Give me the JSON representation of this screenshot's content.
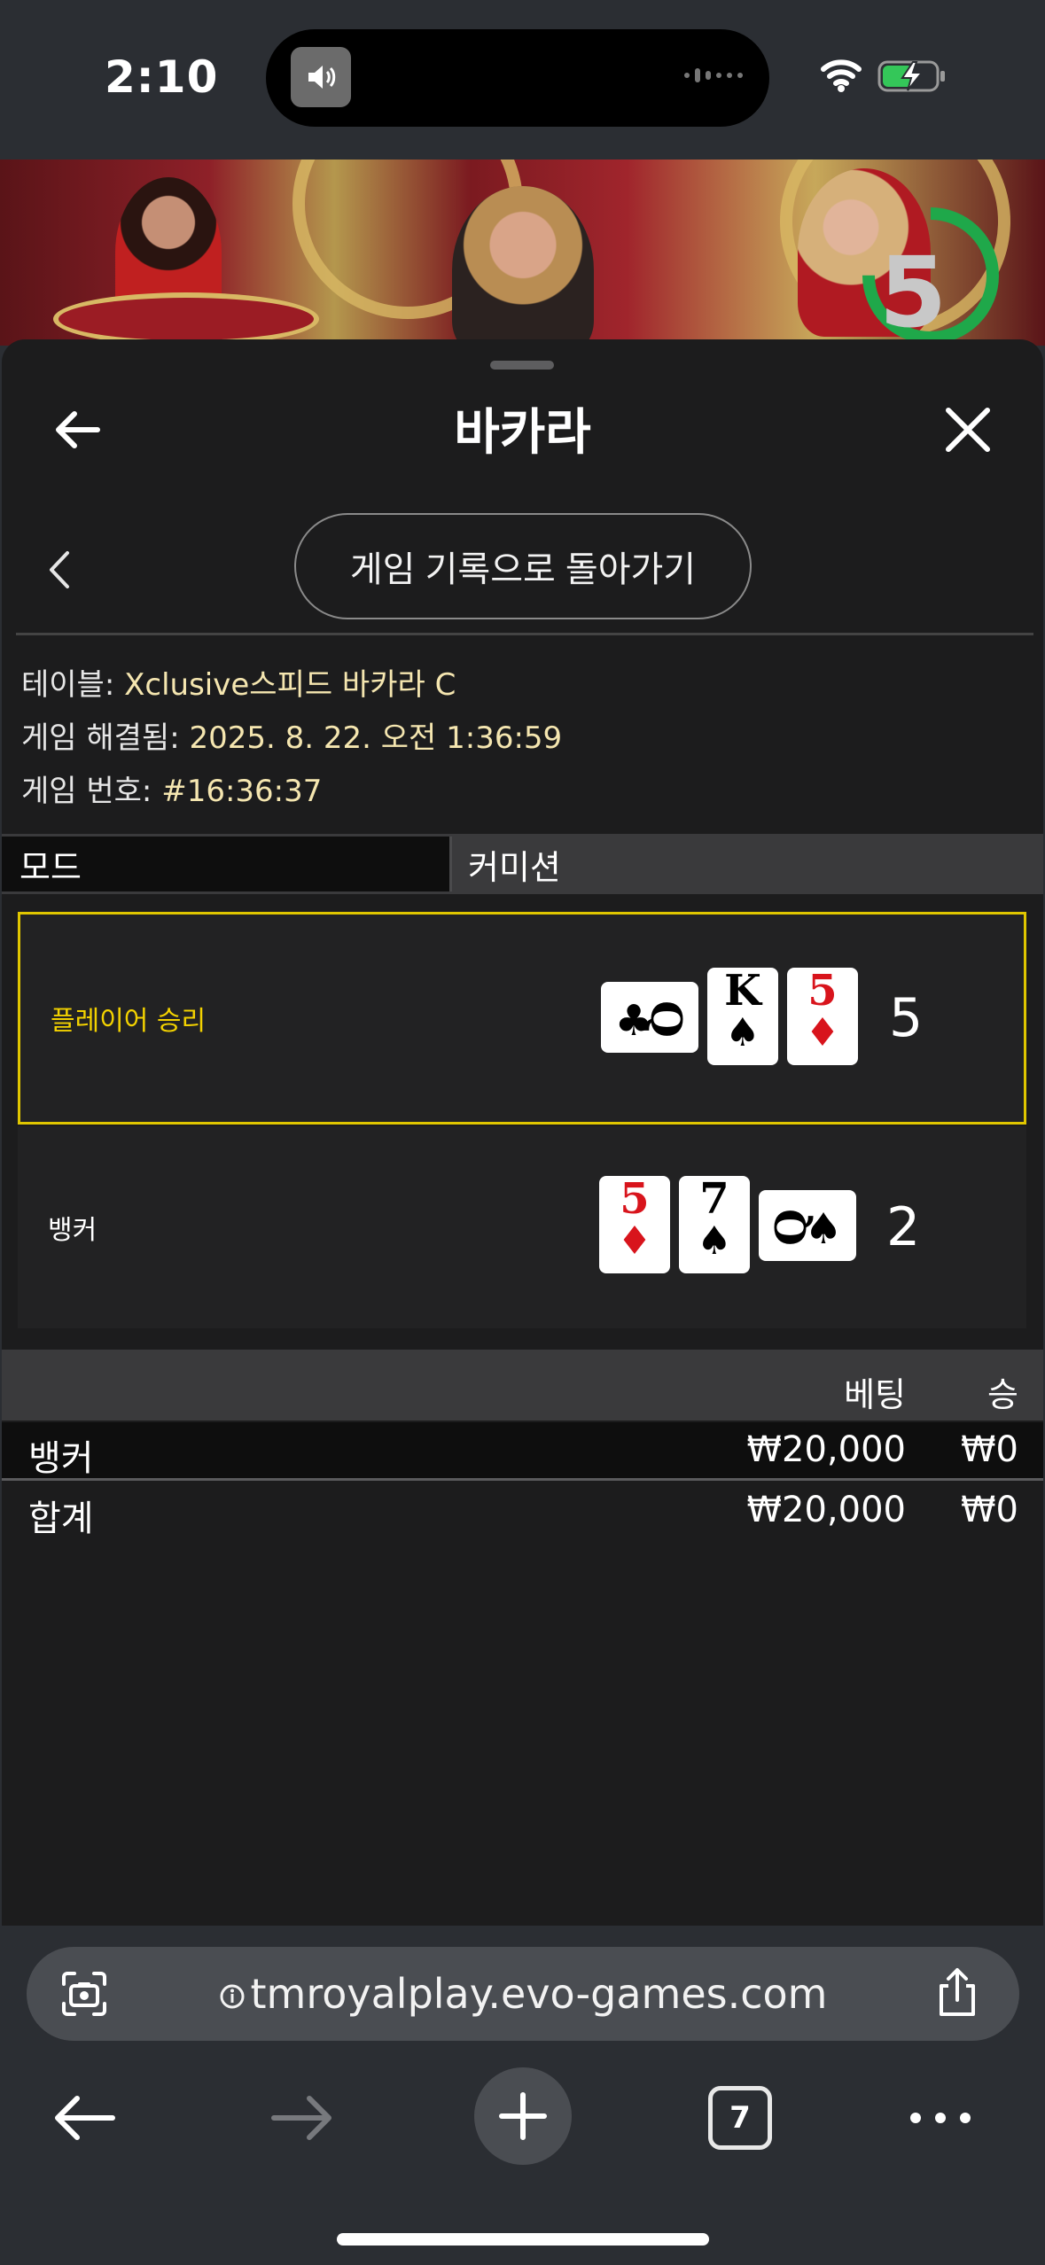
{
  "status_bar": {
    "time": "2:10"
  },
  "video": {
    "countdown": "5"
  },
  "header": {
    "title": "바카라"
  },
  "subheader": {
    "return_label": "게임 기록으로 돌아가기"
  },
  "info": {
    "table_label": "테이블: ",
    "table_value": "Xclusive스피드 바카라 C",
    "resolved_label": "게임 해결됨: ",
    "resolved_value": "2025. 8. 22. 오전 1:36:59",
    "number_label": "게임 번호: ",
    "number_value": "#16:36:37"
  },
  "tabs": {
    "mode": "모드",
    "commission": "커미션"
  },
  "results": {
    "player": {
      "label": "플레이어 승리",
      "score": "5",
      "cards": [
        {
          "rank": "Q",
          "suit": "♣",
          "color": "#000000",
          "orientation": "horizontal"
        },
        {
          "rank": "K",
          "suit": "♠",
          "color": "#000000",
          "orientation": "vertical"
        },
        {
          "rank": "5",
          "suit": "♦",
          "color": "#d8141c",
          "orientation": "vertical"
        }
      ]
    },
    "banker": {
      "label": "뱅커",
      "score": "2",
      "cards": [
        {
          "rank": "5",
          "suit": "♦",
          "color": "#d8141c",
          "orientation": "vertical"
        },
        {
          "rank": "7",
          "suit": "♠",
          "color": "#000000",
          "orientation": "vertical"
        },
        {
          "rank": "Q",
          "suit": "♠",
          "color": "#000000",
          "orientation": "horizontal"
        }
      ]
    }
  },
  "bets": {
    "headers": {
      "bet": "베팅",
      "win": "승"
    },
    "rows": [
      {
        "label": "뱅커",
        "bet": "₩20,000",
        "win": "₩0"
      },
      {
        "label": "합계",
        "bet": "₩20,000",
        "win": "₩0"
      }
    ]
  },
  "browser": {
    "url": "tmroyalplay.evo-games.com",
    "tab_count": "7"
  },
  "colors": {
    "accent_yellow": "#e0c600",
    "card_red": "#d8141c",
    "sheet_bg": "#1c1c1d",
    "timer_green": "#1fa84a"
  }
}
